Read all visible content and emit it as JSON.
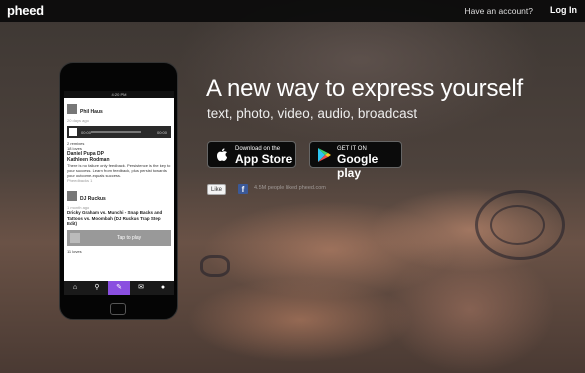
{
  "header": {
    "logo": "pheed",
    "account_prompt": "Have an account?",
    "login_label": "Log In"
  },
  "hero": {
    "headline": "A new way to express yourself",
    "subline": "text, photo, video, audio, broadcast",
    "app_store": {
      "small": "Download on the",
      "big": "App Store"
    },
    "google_play": {
      "small": "GET IT ON",
      "big": "Google play"
    },
    "like_label": "Like",
    "facebook_icon": "f",
    "faint_text": "4.5M people liked pheed.com"
  },
  "phone": {
    "status": "4:20 PM",
    "post1": {
      "author": "Phil Haus",
      "time": "20 days ago",
      "player_time_left": "00:00",
      "player_time_right": "00:00",
      "stats": [
        "2 remixes",
        "18 loves"
      ],
      "commenter1": "Daniel Pupa DP",
      "commenter2": "Kathleen Rodman",
      "comment": "There is no failure only feedback. Persistence is the key to your success. Learn from feedback, plus persist towards your outcome-equals success.",
      "pheedback": "Pheedbacks 1"
    },
    "post2": {
      "author": "DJ Ruckus",
      "time": "1 month ago",
      "title": "Dricky Graham vs. Munchi - Snap Backs and Tattoos vs. Moombah (DJ Ruckus Trap Step Edit)",
      "tap_label": "Tap to play",
      "loves": "11 loves"
    }
  },
  "colors": {
    "accent": "#8a4fe0",
    "facebook": "#3b5998"
  },
  "icons": [
    "apple-icon",
    "google-play-icon",
    "home-icon",
    "search-icon",
    "pheed-icon",
    "chat-icon",
    "profile-icon"
  ]
}
